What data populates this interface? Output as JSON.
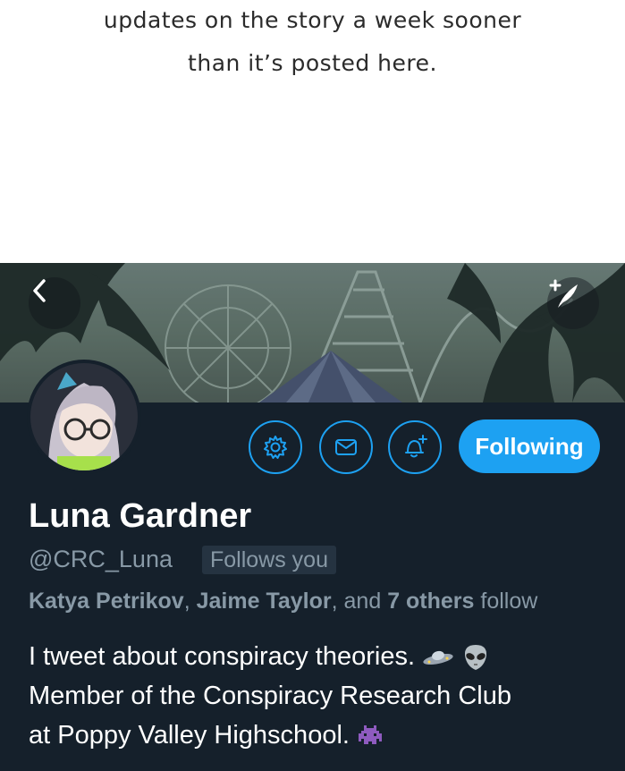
{
  "story": {
    "line1": "updates on the story a week sooner",
    "line2": "than it’s posted here."
  },
  "profile": {
    "display_name": "Luna Gardner",
    "handle": "@CRC_Luna",
    "follows_you": "Follows you",
    "follow_button": "Following",
    "followed_by": {
      "name1": "Katya Petrikov",
      "sep1": ", ",
      "name2": "Jaime Taylor",
      "sep2": ", and ",
      "others": "7 others",
      "suffix": " follow"
    },
    "bio": {
      "line1": "I tweet about conspiracy theories.",
      "line2": "Member of the Conspiracy Research Club",
      "line3": "at Poppy Valley Highschool."
    },
    "emojis": [
      "ufo-icon",
      "alien-icon",
      "space-invader-icon"
    ]
  },
  "colors": {
    "background": "#15202b",
    "accent": "#1da1f2",
    "secondary_text": "#8899a6",
    "primary_text": "#ffffff"
  }
}
